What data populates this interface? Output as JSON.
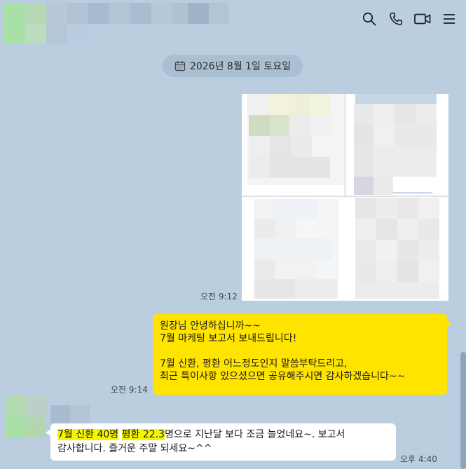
{
  "header": {
    "icons": [
      "search-icon",
      "phone-icon",
      "video-icon",
      "menu-icon"
    ]
  },
  "date_divider": {
    "label": "2026년 8월 1일 토요일",
    "icon": "calendar-icon"
  },
  "messages": {
    "image_time": "오전 9:12",
    "outgoing": {
      "line1": "원장님 안녕하십니까~~",
      "line2": "7월 마케팅 보고서 보내드립니다!",
      "line3": "",
      "line4": "7월 신환, 평환 어느정도인지 말씀부탁드리고,",
      "line5": "최근 특이사항 있으셨으면 공유해주시면 감사하겠습니다~~",
      "time": "오전 9:14"
    },
    "incoming": {
      "seg1": "7월 신환 40명",
      "seg2": " ",
      "seg3": "평환 22.3",
      "seg4": "명으로 지난달 보다 조금 늘었네요~. 보고서",
      "line2": "감사합니다. 즐거운 주말 되세요~^^",
      "time": "오후 4:40"
    }
  },
  "colors": {
    "background": "#bacee0",
    "my_bubble": "#ffe400",
    "their_bubble": "#ffffff",
    "highlight": "#f5f500"
  }
}
